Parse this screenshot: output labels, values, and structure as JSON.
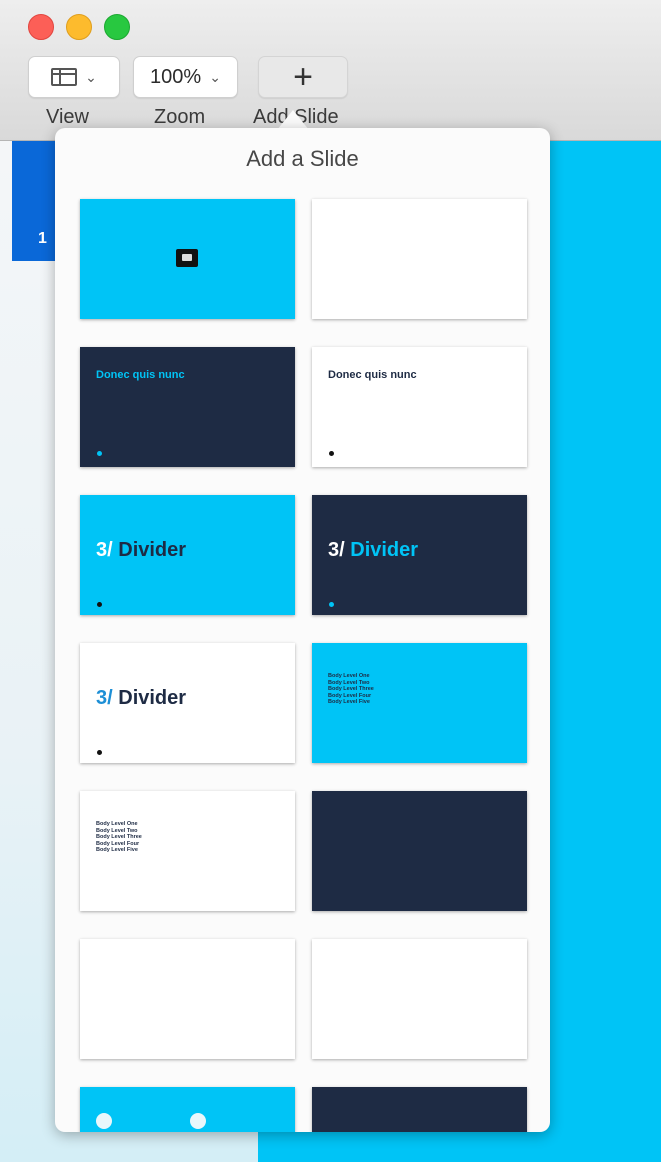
{
  "toolbar": {
    "view_label": "View",
    "zoom_label": "Zoom",
    "zoom_value": "100%",
    "add_slide_label": "Add Slide"
  },
  "navigator": {
    "slide_number": "1"
  },
  "popover": {
    "title": "Add a Slide",
    "thumbnails": [
      {
        "style": "cyan",
        "kind": "photo"
      },
      {
        "style": "white",
        "kind": "blank"
      },
      {
        "style": "navy",
        "kind": "title-bullets",
        "heading": "Donec quis nunc"
      },
      {
        "style": "white",
        "kind": "title-bullets",
        "heading": "Donec quis nunc"
      },
      {
        "style": "cyan",
        "kind": "divider",
        "number": "3/",
        "text": "Divider"
      },
      {
        "style": "navy",
        "kind": "divider",
        "number": "3/",
        "text": "Divider"
      },
      {
        "style": "white",
        "kind": "divider",
        "number": "3/",
        "text": "Divider"
      },
      {
        "style": "cyan",
        "kind": "body",
        "lines": [
          "Body Level One",
          "Body Level Two",
          "Body Level Three",
          "Body Level Four",
          "Body Level Five"
        ]
      },
      {
        "style": "white",
        "kind": "body",
        "lines": [
          "Body Level One",
          "Body Level Two",
          "Body Level Three",
          "Body Level Four",
          "Body Level Five"
        ]
      },
      {
        "style": "navy",
        "kind": "blank"
      },
      {
        "style": "white",
        "kind": "blank"
      },
      {
        "style": "white",
        "kind": "blank"
      },
      {
        "style": "cyan",
        "kind": "photos"
      },
      {
        "style": "navy",
        "kind": "blank"
      }
    ]
  },
  "colors": {
    "cyan": "#00c4f6",
    "navy": "#1e2b44",
    "selection_blue": "#0a68d8"
  }
}
